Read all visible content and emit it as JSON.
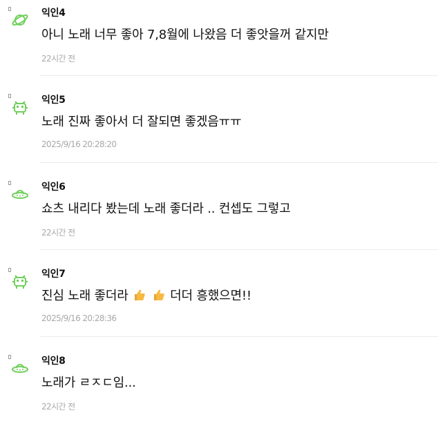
{
  "comments": [
    {
      "nickname": "익인4",
      "avatar": "saturn-icon",
      "text": "아니 노래 너무 좋아 7,8월에 나왔음 더 좋앗을꺼 같지만",
      "time": "22시간 전"
    },
    {
      "nickname": "익인5",
      "avatar": "alien-icon",
      "text": "노래 진짜 좋아서 더 잘되면 좋겠음ㅠㅠ",
      "time": "2025/9/16 20:28:20"
    },
    {
      "nickname": "익인6",
      "avatar": "ufo-icon",
      "text": "쇼츠 내리다 봤는데 노래 좋더라 .. 컨셉도 그렇고",
      "time": "22시간 전"
    },
    {
      "nickname": "익인7",
      "avatar": "alien-icon",
      "text_before": "진심 노래 좋더라",
      "emoji": "thumbs-up-icon",
      "text_after": "더더 흥했으면!!",
      "time": "2025/9/16 20:28:36"
    },
    {
      "nickname": "익인8",
      "avatar": "ufo-icon",
      "text": "노래가 ㄹㅈㄷ임...",
      "time": "22시간 전"
    }
  ],
  "colors": {
    "nickname": "#111111",
    "text": "#111111",
    "meta": "#a8a8a8",
    "icon": "#6fcf5a",
    "divider": "#ececec"
  }
}
